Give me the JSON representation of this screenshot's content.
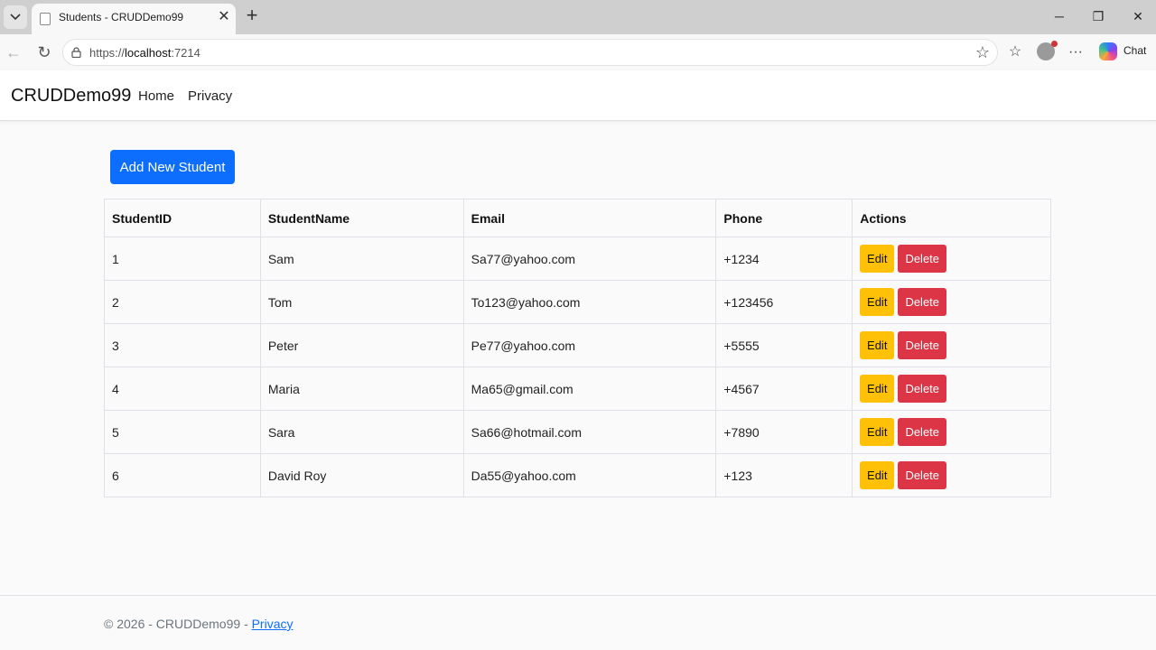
{
  "browser": {
    "tab_title": "Students - CRUDDemo99",
    "url_prefix": "https://",
    "url_host": "localhost",
    "url_port": ":7214",
    "chat_label": "Chat"
  },
  "site": {
    "brand": "CRUDDemo99",
    "nav": [
      {
        "label": "Home"
      },
      {
        "label": "Privacy"
      }
    ]
  },
  "main": {
    "add_button_label": "Add New Student",
    "table": {
      "headers": [
        "StudentID",
        "StudentName",
        "Email",
        "Phone",
        "Actions"
      ],
      "edit_label": "Edit",
      "delete_label": "Delete",
      "rows": [
        {
          "id": "1",
          "name": "Sam",
          "email": "Sa77@yahoo.com",
          "phone": "+1234"
        },
        {
          "id": "2",
          "name": "Tom",
          "email": "To123@yahoo.com",
          "phone": "+123456"
        },
        {
          "id": "3",
          "name": "Peter",
          "email": "Pe77@yahoo.com",
          "phone": "+5555"
        },
        {
          "id": "4",
          "name": "Maria",
          "email": "Ma65@gmail.com",
          "phone": "+4567"
        },
        {
          "id": "5",
          "name": "Sara",
          "email": "Sa66@hotmail.com",
          "phone": "+7890"
        },
        {
          "id": "6",
          "name": "David Roy",
          "email": "Da55@yahoo.com",
          "phone": "+123"
        }
      ]
    }
  },
  "footer": {
    "text": "© 2026 - CRUDDemo99 - ",
    "link": "Privacy"
  },
  "colors": {
    "primary": "#0d6efd",
    "warning": "#ffc107",
    "danger": "#dc3545"
  }
}
